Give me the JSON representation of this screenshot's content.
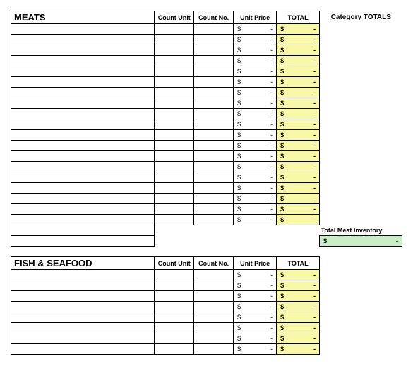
{
  "headers": {
    "count_unit": "Count Unit",
    "count_no": "Count No.",
    "unit_price": "Unit Price",
    "total": "TOTAL",
    "category_totals": "Category TOTALS"
  },
  "currency": "$",
  "dash": "-",
  "sections": [
    {
      "title": "MEATS",
      "row_count": 19,
      "total_label": "Total Meat Inventory"
    },
    {
      "title": "FISH & SEAFOOD",
      "row_count": 8
    }
  ]
}
